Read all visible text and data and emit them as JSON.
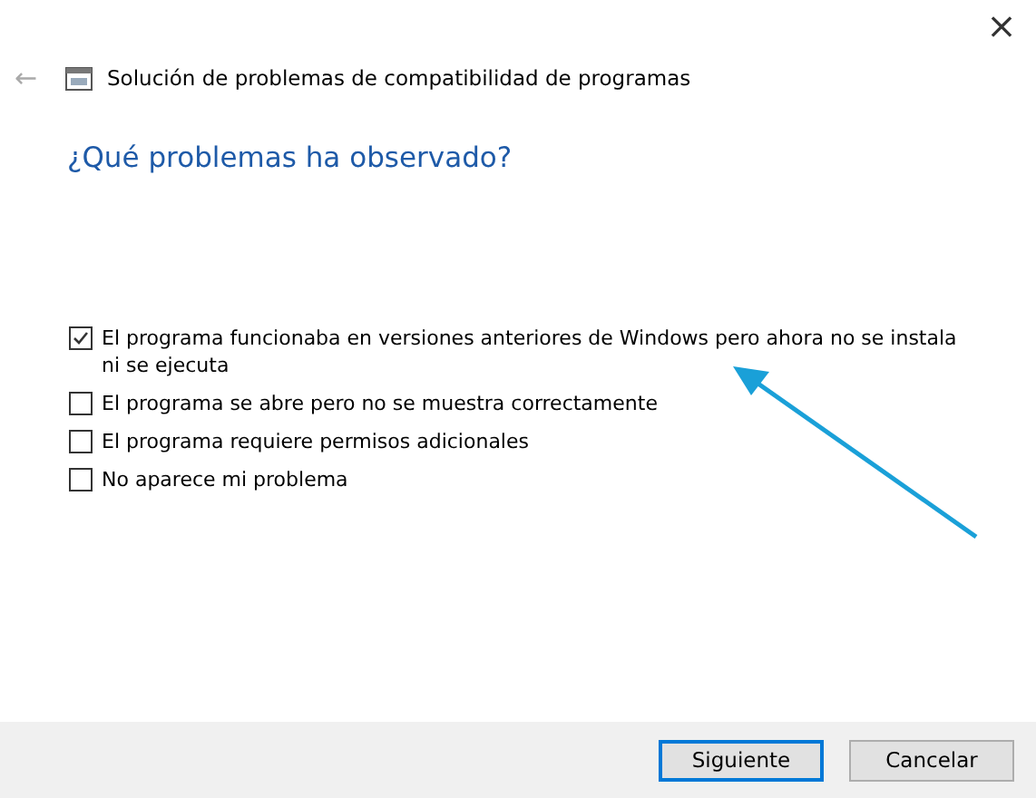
{
  "window": {
    "close": "×",
    "back": "←",
    "title": "Solución de problemas de compatibilidad de programas"
  },
  "heading": "¿Qué problemas ha observado?",
  "options": [
    {
      "label": "El programa funcionaba en versiones anteriores de Windows pero ahora no se instala ni se ejecuta",
      "checked": true
    },
    {
      "label": "El programa se abre pero no se muestra correctamente",
      "checked": false
    },
    {
      "label": "El programa requiere permisos adicionales",
      "checked": false
    },
    {
      "label": "No aparece mi problema",
      "checked": false
    }
  ],
  "buttons": [
    {
      "label": "Siguiente",
      "default": true
    },
    {
      "label": "Cancelar",
      "default": false
    }
  ]
}
